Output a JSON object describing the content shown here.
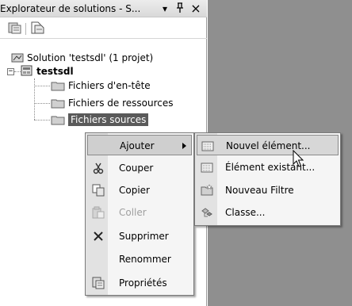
{
  "panel": {
    "title": "Explorateur de solutions - S...",
    "buttons": {
      "dropdown": "▾",
      "pin": "ᵠ",
      "close": "×"
    }
  },
  "toolbar": {
    "items": [
      "properties-icon",
      "show-all-files-icon"
    ]
  },
  "tree": {
    "solution": "Solution 'testsdl' (1 projet)",
    "project": "testsdl",
    "expander_symbol": "−",
    "folders": [
      "Fichiers d'en-tête",
      "Fichiers de ressources",
      "Fichiers sources"
    ]
  },
  "context_menu": {
    "items": [
      {
        "label": "Ajouter",
        "icon": "",
        "has_submenu": true
      },
      {
        "label": "Couper",
        "icon": "scissors-icon"
      },
      {
        "label": "Copier",
        "icon": "copy-icon"
      },
      {
        "label": "Coller",
        "icon": "paste-icon",
        "disabled": true
      },
      {
        "label": "Supprimer",
        "icon": "delete-icon"
      },
      {
        "label": "Renommer",
        "icon": ""
      },
      {
        "label": "Propriétés",
        "icon": "properties-icon"
      }
    ]
  },
  "submenu": {
    "items": [
      {
        "label": "Nouvel élément...",
        "icon": "new-item-icon"
      },
      {
        "label": "Élément existant...",
        "icon": "existing-item-icon"
      },
      {
        "label": "Nouveau Filtre",
        "icon": "new-folder-icon"
      },
      {
        "label": "Classe...",
        "icon": "class-icon"
      }
    ]
  }
}
